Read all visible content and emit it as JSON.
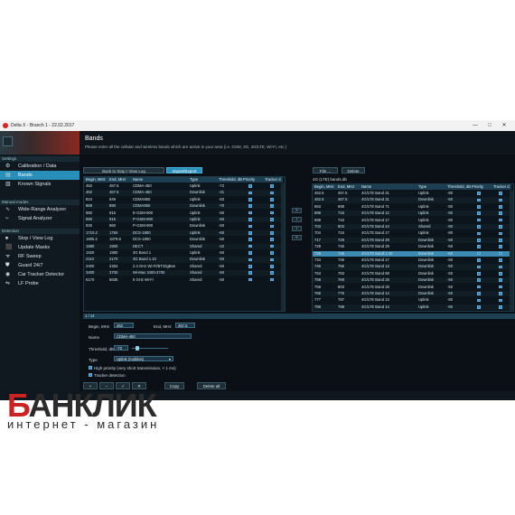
{
  "titlebar": {
    "title": "Delta X - Branch 1 - 22.02.2017",
    "min": "—",
    "max": "□",
    "close": "✕"
  },
  "sidebar": {
    "sections": [
      "Settings",
      "Manual modes",
      "Detection"
    ],
    "items": [
      {
        "label": "Calibration / Data",
        "icon": "⚙"
      },
      {
        "label": "Bands",
        "icon": "▤"
      },
      {
        "label": "Known Signals",
        "icon": "▥"
      },
      {
        "label": "Wide-Range Analyzer",
        "icon": "∿"
      },
      {
        "label": "Signal Analyzer",
        "icon": "⌁"
      },
      {
        "label": "Stop / View Log",
        "icon": "⏹"
      },
      {
        "label": "Update Masks",
        "icon": "⬛"
      },
      {
        "label": "RF Sweep",
        "icon": "ᯤ"
      },
      {
        "label": "Guard 24/7",
        "icon": "⛊"
      },
      {
        "label": "Car Tracker Detector",
        "icon": "◉"
      },
      {
        "label": "LF Probe",
        "icon": "⇋"
      }
    ]
  },
  "header": {
    "title": "Bands",
    "subtitle": "Please enter all the cellular and wireless bands which are active in your area (i.e. GSM, 3G, 4G/LTE, Wi-Fi, etc.)"
  },
  "buttons": {
    "back": "Back to Stop / View Log",
    "import": "Import/Export",
    "file": "File ...",
    "delete": "Delete",
    "copy": "Copy",
    "delete_all": "Delete all"
  },
  "left_table": {
    "columns": [
      "Begin, MHz",
      "End, MHz",
      "Name",
      "Type",
      "Threshold, dBm",
      "Priority",
      "Tracker d"
    ],
    "rows": [
      [
        "452",
        "457.5",
        "CDMA-450",
        "Uplink",
        "-72"
      ],
      [
        "462",
        "467.5",
        "CDMA-450",
        "Downlink",
        "-41"
      ],
      [
        "824",
        "849",
        "CDMA850",
        "Uplink",
        "-83"
      ],
      [
        "869",
        "890",
        "CDMA850",
        "Downlink",
        "-70"
      ],
      [
        "880",
        "915",
        "E-GSM-900",
        "Uplink",
        "-60"
      ],
      [
        "890",
        "915",
        "P-GSM-900",
        "Uplink",
        "-60"
      ],
      [
        "925",
        "960",
        "P-GSM-900",
        "Downlink",
        "-50"
      ],
      [
        "1710.2",
        "1784",
        "DCS-1800",
        "Uplink",
        "-60"
      ],
      [
        "1805.2",
        "1879.8",
        "DCS-1800",
        "Downlink",
        "-50"
      ],
      [
        "1880",
        "1900",
        "DECT",
        "Shared",
        "-42"
      ],
      [
        "1920",
        "1980",
        "3G Band 1",
        "Uplink",
        "-50"
      ],
      [
        "2110",
        "2170",
        "3G Band 1.10",
        "Downlink",
        "-50"
      ],
      [
        "2400",
        "2484",
        "2.4 GHz Wi-Fi/BT/ZigBee",
        "Shared",
        "-50"
      ],
      [
        "3400",
        "3700",
        "Wi-Max 3400-3700",
        "Shared",
        "-50"
      ],
      [
        "5170",
        "5835",
        "5 GHz Wi-Fi",
        "Shared",
        "-50"
      ]
    ]
  },
  "right_table": {
    "file": "4G (LTE) bands.db",
    "columns": [
      "Begin, MHz",
      "End, MHz",
      "Name",
      "Type",
      "Threshold, dBm",
      "Priority",
      "Tracker d"
    ],
    "rows": [
      [
        "452.5",
        "457.5",
        "4G/LTE Band 31",
        "Uplink",
        "-80"
      ],
      [
        "462.5",
        "467.5",
        "4G/LTE Band 31",
        "Downlink",
        "-50"
      ],
      [
        "663",
        "698",
        "4G/LTE Band 71",
        "Uplink",
        "-80"
      ],
      [
        "698",
        "716",
        "4G/LTE Band 12",
        "Uplink",
        "-80"
      ],
      [
        "699",
        "716",
        "4G/LTE Band 17",
        "Uplink",
        "-80"
      ],
      [
        "703",
        "803",
        "4G/LTE Band 44",
        "Shared",
        "-60"
      ],
      [
        "704",
        "716",
        "4G/LTE Band 17",
        "Uplink",
        "-80"
      ],
      [
        "717",
        "728",
        "4G/LTE Band 29",
        "Downlink",
        "-50"
      ],
      [
        "728",
        "746",
        "4G/LTE Band 29",
        "Downlink",
        "-50"
      ],
      [
        "729",
        "746",
        "4G/LTE Band 1.10",
        "Downlink",
        "-50"
      ],
      [
        "734",
        "746",
        "4G/LTE Band 17",
        "Downlink",
        "-50"
      ],
      [
        "746",
        "756",
        "4G/LTE Band 13",
        "Downlink",
        "-50"
      ],
      [
        "753",
        "763",
        "4G/LTE Band 68",
        "Downlink",
        "-50"
      ],
      [
        "758",
        "768",
        "4G/LTE Band 28",
        "Downlink",
        "-50"
      ],
      [
        "758",
        "803",
        "4G/LTE Band 28",
        "Downlink",
        "-50"
      ],
      [
        "768",
        "776",
        "4G/LTE Band 14",
        "Downlink",
        "-50"
      ],
      [
        "777",
        "787",
        "4G/LTE Band 13",
        "Uplink",
        "-80"
      ],
      [
        "788",
        "798",
        "4G/LTE Band 14",
        "Uplink",
        "-80"
      ]
    ]
  },
  "pager": "1 / 14",
  "form": {
    "begin_label": "Begin, MHz",
    "begin_value": "452",
    "end_label": "End, MHz",
    "end_value": "457.5",
    "name_label": "Name",
    "name_value": "CDMA-450",
    "threshold_label": "Threshold, dB",
    "threshold_value": "-72",
    "type_label": "Type",
    "type_value": "Uplink (mobiles)",
    "high_priority": "High priority (very short transmission, < 1 ms)",
    "tracker": "Tracker detection"
  },
  "toolbar": {
    "add": "+",
    "remove": "−",
    "ok": "✓",
    "cancel": "✕"
  },
  "watermark": {
    "brand_b": "Б",
    "brand_rest": "АНКЛИК",
    "tag": "интернет - магазин"
  }
}
